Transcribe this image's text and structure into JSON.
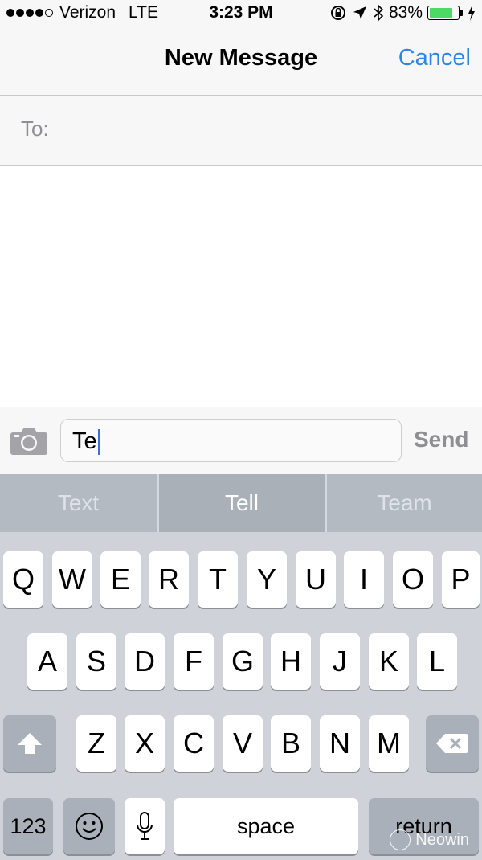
{
  "status_bar": {
    "signal_dots": [
      true,
      true,
      true,
      true,
      false
    ],
    "carrier": "Verizon",
    "network": "LTE",
    "time": "3:23 PM",
    "battery_percent_text": "83%",
    "battery_level": 0.83,
    "icons": [
      "rotation-lock-icon",
      "location-arrow-icon",
      "bluetooth-icon",
      "battery-icon",
      "charging-bolt-icon"
    ]
  },
  "navbar": {
    "title": "New Message",
    "cancel_label": "Cancel"
  },
  "to_field": {
    "label": "To:"
  },
  "composer": {
    "text": "Te",
    "send_label": "Send"
  },
  "suggestions": [
    "Text",
    "Tell",
    "Team"
  ],
  "keyboard": {
    "row1": [
      "Q",
      "W",
      "E",
      "R",
      "T",
      "Y",
      "U",
      "I",
      "O",
      "P"
    ],
    "row2": [
      "A",
      "S",
      "D",
      "F",
      "G",
      "H",
      "J",
      "K",
      "L"
    ],
    "row3": [
      "Z",
      "X",
      "C",
      "V",
      "B",
      "N",
      "M"
    ],
    "numbers_label": "123",
    "space_label": "space",
    "return_label": "return"
  },
  "watermark": "Neowin",
  "colors": {
    "accent": "#2d86e5",
    "battery": "#4cd964",
    "keyboard_bg": "#cfd3d9"
  }
}
